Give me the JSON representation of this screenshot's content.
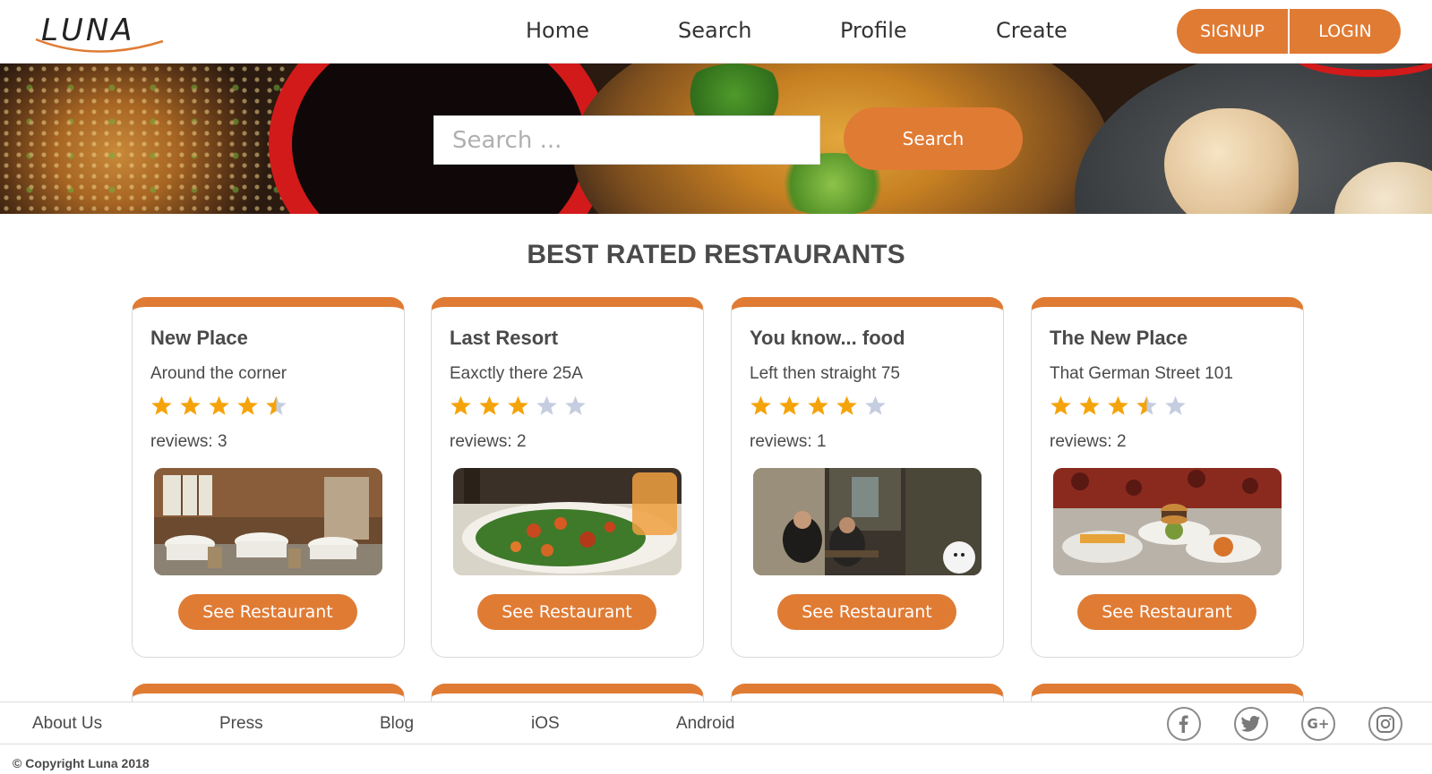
{
  "header": {
    "logo_text": "LUNA",
    "nav": [
      {
        "label": "Home"
      },
      {
        "label": "Search"
      },
      {
        "label": "Profile"
      },
      {
        "label": "Create"
      }
    ],
    "signup_label": "SIGNUP",
    "login_label": "LOGIN"
  },
  "hero": {
    "search_placeholder": "Search ...",
    "search_button": "Search"
  },
  "section": {
    "title": "BEST RATED RESTAURANTS"
  },
  "restaurants": [
    {
      "name": "New Place",
      "address": "Around the corner",
      "rating": 4.5,
      "reviews_text": "reviews: 3",
      "button": "See Restaurant",
      "photo": "dining-room"
    },
    {
      "name": "Last Resort",
      "address": "Eaxctly there 25A",
      "rating": 3,
      "reviews_text": "reviews: 2",
      "button": "See Restaurant",
      "photo": "seafood-salad"
    },
    {
      "name": "You know... food",
      "address": "Left then straight 75",
      "rating": 4,
      "reviews_text": "reviews: 1",
      "button": "See Restaurant",
      "photo": "pub-interior"
    },
    {
      "name": "The New Place",
      "address": "That German Street 101",
      "rating": 3.5,
      "reviews_text": "reviews: 2",
      "button": "See Restaurant",
      "photo": "burger-table"
    }
  ],
  "footer": {
    "links": [
      {
        "label": "About Us"
      },
      {
        "label": "Press"
      },
      {
        "label": "Blog"
      },
      {
        "label": "iOS"
      },
      {
        "label": "Android"
      }
    ],
    "social": [
      "facebook-icon",
      "twitter-icon",
      "google-plus-icon",
      "instagram-icon"
    ],
    "copyright": "© Copyright Luna 2018"
  },
  "colors": {
    "accent": "#e07b34",
    "star_filled": "#f5a30a",
    "star_empty": "#c5cde0",
    "text": "#4a4a4a"
  }
}
